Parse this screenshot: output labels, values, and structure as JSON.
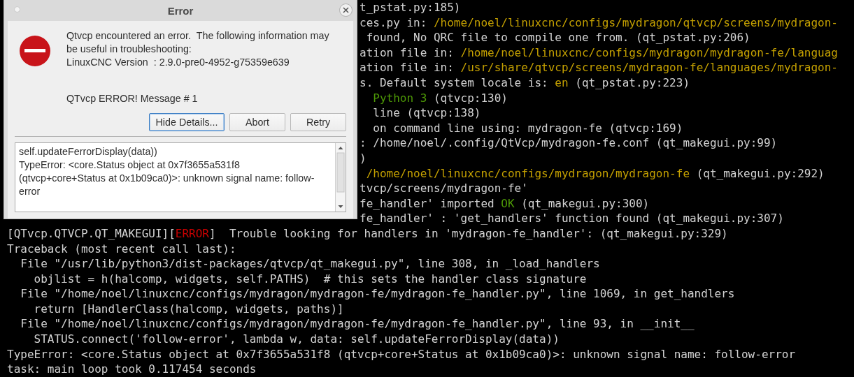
{
  "terminal": {
    "lines": [
      {
        "covered": true,
        "segments": [
          {
            "text": "t_pstat.py:185)",
            "color": "#d3d3d3"
          }
        ]
      },
      {
        "covered": true,
        "segments": [
          {
            "text": "ces.py in: ",
            "color": "#d3d3d3"
          },
          {
            "text": "/home/noel/linuxcnc/configs/mydragon/qtvcp/screens/mydragon-",
            "color": "#c4a000"
          }
        ]
      },
      {
        "covered": true,
        "segments": [
          {
            "text": " found, No QRC file to compile one from. (qt_pstat.py:206)",
            "color": "#d3d3d3"
          }
        ]
      },
      {
        "covered": true,
        "segments": [
          {
            "text": "ation file in: ",
            "color": "#d3d3d3"
          },
          {
            "text": "/home/noel/linuxcnc/configs/mydragon/mydragon-fe/languag",
            "color": "#c4a000"
          }
        ]
      },
      {
        "covered": true,
        "segments": [
          {
            "text": "ation file in: ",
            "color": "#d3d3d3"
          },
          {
            "text": "/usr/share/qtvcp/screens/mydragon-fe/languages/mydragon-",
            "color": "#c4a000"
          }
        ]
      },
      {
        "covered": true,
        "segments": [
          {
            "text": "s. Default system locale is: ",
            "color": "#d3d3d3"
          },
          {
            "text": "en",
            "color": "#c4a000"
          },
          {
            "text": " (qt_pstat.py:223)",
            "color": "#d3d3d3"
          }
        ]
      },
      {
        "covered": true,
        "segments": [
          {
            "text": "  Python 3",
            "color": "#4e9a06"
          },
          {
            "text": " (qtvcp:130)",
            "color": "#d3d3d3"
          }
        ]
      },
      {
        "covered": true,
        "segments": [
          {
            "text": "  line (qtvcp:138)",
            "color": "#d3d3d3"
          }
        ]
      },
      {
        "covered": true,
        "segments": [
          {
            "text": "  on command line using: mydragon-fe (qtvcp:169)",
            "color": "#d3d3d3"
          }
        ]
      },
      {
        "covered": true,
        "segments": [
          {
            "text": ": /home/noel/.config/QtVcp/mydragon-fe.conf (qt_makegui.py:99)",
            "color": "#d3d3d3"
          }
        ]
      },
      {
        "covered": true,
        "segments": [
          {
            "text": ")",
            "color": "#d3d3d3"
          }
        ]
      },
      {
        "covered": true,
        "segments": [
          {
            "text": " /home/noel/linuxcnc/configs/mydragon/mydragon-fe",
            "color": "#c4a000"
          },
          {
            "text": " (qt_makegui.py:292)",
            "color": "#d3d3d3"
          }
        ]
      },
      {
        "covered": true,
        "segments": [
          {
            "text": "tvcp/screens/mydragon-fe'",
            "color": "#d3d3d3"
          }
        ]
      },
      {
        "covered": true,
        "segments": [
          {
            "text": "fe_handler' imported ",
            "color": "#d3d3d3"
          },
          {
            "text": "OK",
            "color": "#4e9a06"
          },
          {
            "text": " (qt_makegui.py:300)",
            "color": "#d3d3d3"
          }
        ]
      },
      {
        "covered": true,
        "segments": [
          {
            "text": "fe_handler' : 'get_handlers' function found (qt_makegui.py:307)",
            "color": "#d3d3d3"
          }
        ]
      },
      {
        "covered": false,
        "segments": [
          {
            "text": "[QTvcp.QTVCP.QT_MAKEGUI][",
            "color": "#d3d3d3"
          },
          {
            "text": "ERROR",
            "color": "#cc0000"
          },
          {
            "text": "]  Trouble looking for handlers in 'mydragon-fe_handler': (qt_makegui.py:329)",
            "color": "#d3d3d3"
          }
        ]
      },
      {
        "covered": false,
        "segments": [
          {
            "text": "Traceback (most recent call last):",
            "color": "#d3d3d3"
          }
        ]
      },
      {
        "covered": false,
        "segments": [
          {
            "text": "  File \"/usr/lib/python3/dist-packages/qtvcp/qt_makegui.py\", line 308, in _load_handlers",
            "color": "#d3d3d3"
          }
        ]
      },
      {
        "covered": false,
        "segments": [
          {
            "text": "    objlist = h(halcomp, widgets, self.PATHS)  # this sets the handler class signature",
            "color": "#d3d3d3"
          }
        ]
      },
      {
        "covered": false,
        "segments": [
          {
            "text": "  File \"/home/noel/linuxcnc/configs/mydragon/mydragon-fe/mydragon-fe_handler.py\", line 1069, in get_handlers",
            "color": "#d3d3d3"
          }
        ]
      },
      {
        "covered": false,
        "segments": [
          {
            "text": "    return [HandlerClass(halcomp, widgets, paths)]",
            "color": "#d3d3d3"
          }
        ]
      },
      {
        "covered": false,
        "segments": [
          {
            "text": "  File \"/home/noel/linuxcnc/configs/mydragon/mydragon-fe/mydragon-fe_handler.py\", line 93, in __init__",
            "color": "#d3d3d3"
          }
        ]
      },
      {
        "covered": false,
        "segments": [
          {
            "text": "    STATUS.connect('follow-error', lambda w, data: self.updateFerrorDisplay(data))",
            "color": "#d3d3d3"
          }
        ]
      },
      {
        "covered": false,
        "segments": [
          {
            "text": "TypeError: <core.Status object at 0x7f3655a531f8 (qtvcp+core+Status at 0x1b09ca0)>: unknown signal name: follow-error",
            "color": "#d3d3d3"
          }
        ]
      },
      {
        "covered": false,
        "segments": [
          {
            "text": "task: main loop took 0.117454 seconds",
            "color": "#d3d3d3"
          }
        ]
      }
    ]
  },
  "dialog": {
    "title": "Error",
    "message_lines": [
      "Qtvcp encountered an error.  The following information may",
      "be useful in troubleshooting:",
      "LinuxCNC Version  : 2.9.0-pre0-4952-g75359e639"
    ],
    "informative": "QTvcp ERROR! Message # 1",
    "buttons": [
      {
        "label": "Hide Details...",
        "default": true
      },
      {
        "label": "Abort",
        "default": false
      },
      {
        "label": "Retry",
        "default": false
      }
    ],
    "details_lines": [
      "self.updateFerrorDisplay(data))",
      "TypeError: <core.Status object at 0x7f3655a531f8",
      "(qtvcp+core+Status at 0x1b09ca0)>: unknown signal name: follow-",
      "error"
    ]
  }
}
